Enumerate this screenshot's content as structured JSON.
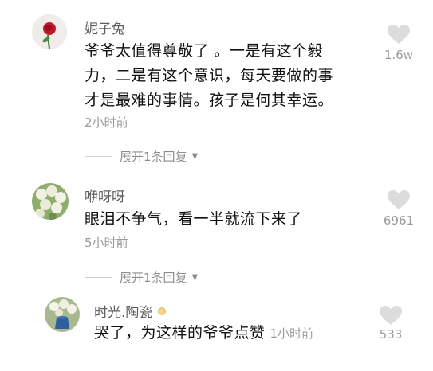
{
  "comments": [
    {
      "username": "妮子兔",
      "text_lines": [
        "爷爷太值得尊敬了 。一是有这个毅",
        "力，二是有这个意识，每天要做的事",
        "才是最难的事情。孩子是何其幸运。"
      ],
      "time": "2小时前",
      "likes": "1.6w",
      "expand_label": "展开1条回复"
    },
    {
      "username": "咿呀呀",
      "text_lines": [
        "眼泪不争气，看一半就流下来了"
      ],
      "time": "5小时前",
      "likes": "6961",
      "expand_label": "展开1条回复"
    }
  ],
  "reply": {
    "username": "时光.陶瓷",
    "text": "哭了，为这样的爷爷点赞",
    "time": "1小时前",
    "likes": "533"
  },
  "icons": {
    "like": "heart-icon",
    "expand": "caret-down-icon",
    "badge": "sun-badge-icon"
  },
  "colors": {
    "username": "#5e5e5e",
    "secondary": "#9a9a9a",
    "heart": "#dcdcdc"
  }
}
